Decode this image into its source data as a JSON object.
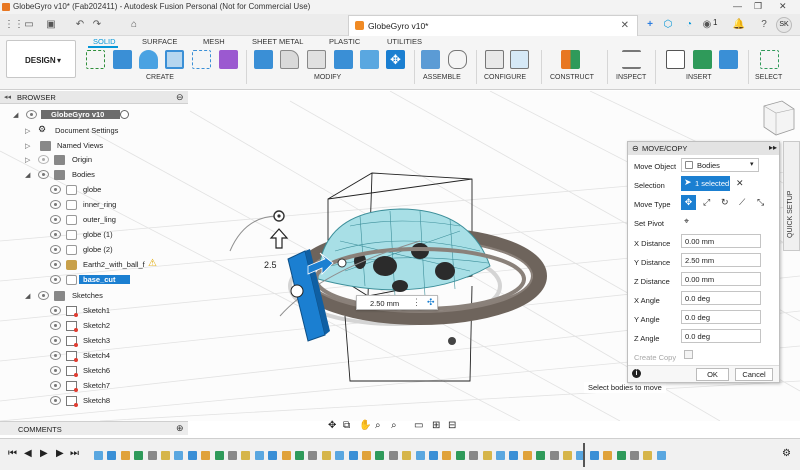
{
  "window": {
    "title": "GlobeGyro v10* (Fab202411) - Autodesk Fusion Personal (Not for Commercial Use)",
    "controls": [
      "minimize-icon",
      "restore-icon",
      "close-icon"
    ]
  },
  "doc_tab": {
    "label": "GlobeGyro v10*"
  },
  "quick_access": {
    "user_initials": "SK",
    "job_count": "1"
  },
  "workspace": {
    "label": "DESIGN"
  },
  "ribbon": {
    "tabs": [
      {
        "label": "SOLID",
        "active": true
      },
      {
        "label": "SURFACE",
        "active": false
      },
      {
        "label": "MESH",
        "active": false
      },
      {
        "label": "SHEET METAL",
        "active": false
      },
      {
        "label": "PLASTIC",
        "active": false
      },
      {
        "label": "UTILITIES",
        "active": false
      }
    ],
    "groups": [
      {
        "label": "CREATE"
      },
      {
        "label": "MODIFY"
      },
      {
        "label": "ASSEMBLE"
      },
      {
        "label": "CONFIGURE"
      },
      {
        "label": "CONSTRUCT"
      },
      {
        "label": "INSPECT"
      },
      {
        "label": "INSERT"
      },
      {
        "label": "SELECT"
      }
    ]
  },
  "browser": {
    "header": "BROWSER",
    "root": "GlobeGyro v10",
    "items": [
      {
        "label": "Document Settings"
      },
      {
        "label": "Named Views"
      },
      {
        "label": "Origin"
      },
      {
        "label": "Bodies"
      },
      {
        "label": "globe"
      },
      {
        "label": "inner_ring"
      },
      {
        "label": "outer_ling"
      },
      {
        "label": "globe (1)"
      },
      {
        "label": "globe (2)"
      },
      {
        "label": "Earth2_with_ball_f"
      },
      {
        "label": "base_cut"
      },
      {
        "label": "Sketches"
      },
      {
        "label": "Sketch1"
      },
      {
        "label": "Sketch2"
      },
      {
        "label": "Sketch3"
      },
      {
        "label": "Sketch4"
      },
      {
        "label": "Sketch6"
      },
      {
        "label": "Sketch7"
      },
      {
        "label": "Sketch8"
      }
    ]
  },
  "comments": {
    "label": "COMMENTS"
  },
  "viewport": {
    "manipulator_value": "2.50 mm",
    "arrow_label": "2.5",
    "hint": "Select bodies to move",
    "selected_body": "base_cut"
  },
  "move_copy": {
    "title": "MOVE/COPY",
    "rows": {
      "move_object": {
        "label": "Move Object",
        "value": "Bodies"
      },
      "selection": {
        "label": "Selection",
        "value": "1 selected"
      },
      "move_type": {
        "label": "Move Type"
      },
      "set_pivot": {
        "label": "Set Pivot"
      },
      "x_distance": {
        "label": "X Distance",
        "value": "0.00 mm"
      },
      "y_distance": {
        "label": "Y Distance",
        "value": "2.50 mm"
      },
      "z_distance": {
        "label": "Z Distance",
        "value": "0.00 mm"
      },
      "x_angle": {
        "label": "X Angle",
        "value": "0.0 deg"
      },
      "y_angle": {
        "label": "Y Angle",
        "value": "0.0 deg"
      },
      "z_angle": {
        "label": "Z Angle",
        "value": "0.0 deg"
      },
      "create_copy": {
        "label": "Create Copy",
        "checked": false
      }
    },
    "ok_label": "OK",
    "cancel_label": "Cancel"
  },
  "quick_setup": {
    "label": "QUICK SETUP"
  },
  "colors": {
    "accent": "#0696d7",
    "selection": "#1b7fd1",
    "model_cyan": "#a8dfe6",
    "ring_gray": "#6e645c"
  }
}
